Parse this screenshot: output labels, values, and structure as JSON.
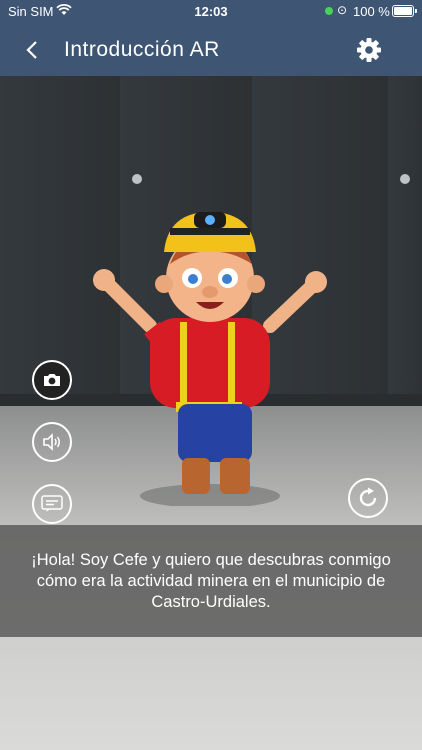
{
  "status_bar": {
    "carrier": "Sin SIM",
    "time": "12:03",
    "battery": "100 %"
  },
  "nav": {
    "title": "Introducción AR"
  },
  "buttons": {
    "camera": "camera-icon",
    "sound": "speaker-icon",
    "subtitles": "subtitles-icon",
    "reset": "refresh-icon"
  },
  "message": {
    "text": "¡Hola! Soy Cefe y quiero que descubras conmigo cómo era la actividad minera en el municipio de Castro-Urdiales."
  },
  "colors": {
    "header": "#3e5573",
    "panel": "#5a5a5a"
  }
}
